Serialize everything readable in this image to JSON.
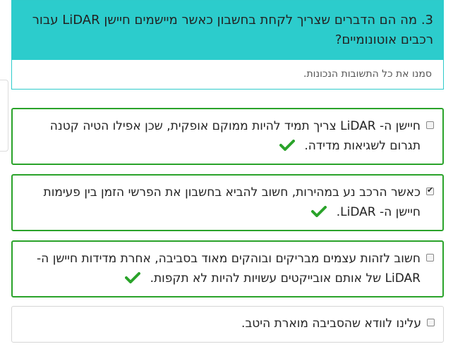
{
  "question": {
    "text": "3. מה הם הדברים שצריך לקחת בחשבון כאשר מיישמים חיישן LiDAR עבור רכבים אוטונומיים?",
    "instruction": "סמנו את כל התשובות הנכונות."
  },
  "answers": [
    {
      "text": "חיישן ה- LiDAR צריך תמיד להיות ממוקם אופקית, שכן אפילו הטיה קטנה תגרום לשגיאות מדידה.",
      "checked": false,
      "marked_correct": true
    },
    {
      "text": "כאשר הרכב נע במהירות, חשוב להביא בחשבון את הפרשי הזמן בין פעימות חיישן ה- LiDAR.",
      "checked": true,
      "marked_correct": true
    },
    {
      "text": "חשוב לזהות עצמים מבריקים ובוהקים מאוד בסביבה, אחרת מדידות חיישן ה- LiDAR של אותם אובייקטים עשויות להיות לא תקפות.",
      "checked": false,
      "marked_correct": true
    },
    {
      "text": "עלינו לוודא שהסביבה מוארת היטב.",
      "checked": false,
      "marked_correct": false
    }
  ],
  "colors": {
    "header_bg": "#2ccccc",
    "correct_border": "#2aa32a",
    "check_icon": "#2aa32a"
  },
  "icons": {
    "correct": "check-mark-icon"
  }
}
